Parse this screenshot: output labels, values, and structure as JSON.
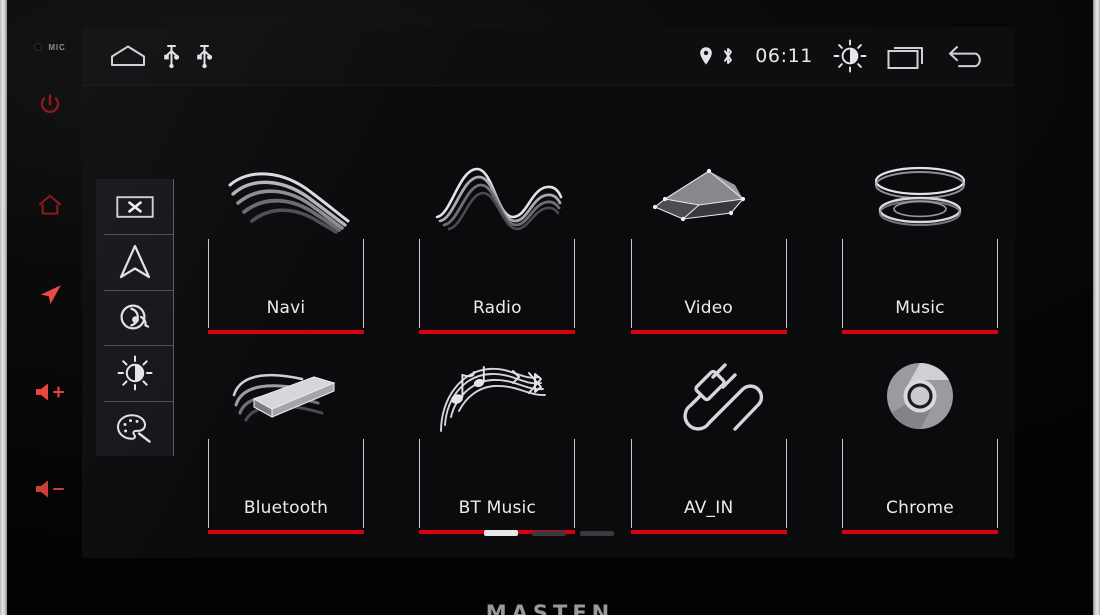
{
  "device": {
    "brand_text": "MASTEN",
    "mic_label": "MIC",
    "hardkeys": [
      {
        "name": "power",
        "icon": "power-icon"
      },
      {
        "name": "home",
        "icon": "home-icon"
      },
      {
        "name": "navigation",
        "icon": "navigation-arrow-icon"
      },
      {
        "name": "volume-up",
        "icon": "volume-up-icon"
      },
      {
        "name": "volume-down",
        "icon": "volume-down-icon"
      }
    ],
    "colors": {
      "accent_red": "#d7000f",
      "hardkey_dim_red": "#8c1b1b",
      "hardkey_bright_red": "#f04a44",
      "screen_bg": "#0b0b0d",
      "statusbar_bg": "#0e0e10",
      "dock_bg": "#16161a",
      "frame_line": "#c9c9ce",
      "label_text": "#ececed"
    }
  },
  "statusbar": {
    "left_icons": [
      {
        "name": "home-icon",
        "label": "Home"
      },
      {
        "name": "usb-icon-1",
        "label": "USB 1"
      },
      {
        "name": "usb-icon-2",
        "label": "USB 2"
      }
    ],
    "location_icon": "location-pin-icon",
    "bluetooth_icon": "bluetooth-icon",
    "clock": "06:11",
    "right_icons": [
      {
        "name": "brightness-icon",
        "label": "Brightness"
      },
      {
        "name": "recents-icon",
        "label": "Recent apps"
      },
      {
        "name": "back-icon",
        "label": "Back"
      }
    ]
  },
  "dock": {
    "items": [
      {
        "name": "screen-off",
        "icon": "screen-off-icon",
        "label": "Screen Off"
      },
      {
        "name": "navigation",
        "icon": "navigation-arrow-icon",
        "label": "Navigation"
      },
      {
        "name": "radio",
        "icon": "radio-icon",
        "label": "Radio"
      },
      {
        "name": "brightness",
        "icon": "brightness-icon",
        "label": "Brightness"
      },
      {
        "name": "theme",
        "icon": "palette-icon",
        "label": "Theme"
      }
    ]
  },
  "apps": {
    "rows": [
      [
        {
          "label": "Navi",
          "icon": "navi-swoosh-icon"
        },
        {
          "label": "Radio",
          "icon": "radio-wave-icon"
        },
        {
          "label": "Video",
          "icon": "video-polygon-icon"
        },
        {
          "label": "Music",
          "icon": "music-disc-icon"
        }
      ],
      [
        {
          "label": "Bluetooth",
          "icon": "bluetooth-device-icon"
        },
        {
          "label": "BT Music",
          "icon": "bt-music-notes-icon"
        },
        {
          "label": "AV_IN",
          "icon": "av-cable-icon"
        },
        {
          "label": "Chrome",
          "icon": "chrome-icon"
        }
      ]
    ]
  },
  "pager": {
    "pages": 3,
    "active": 1
  }
}
